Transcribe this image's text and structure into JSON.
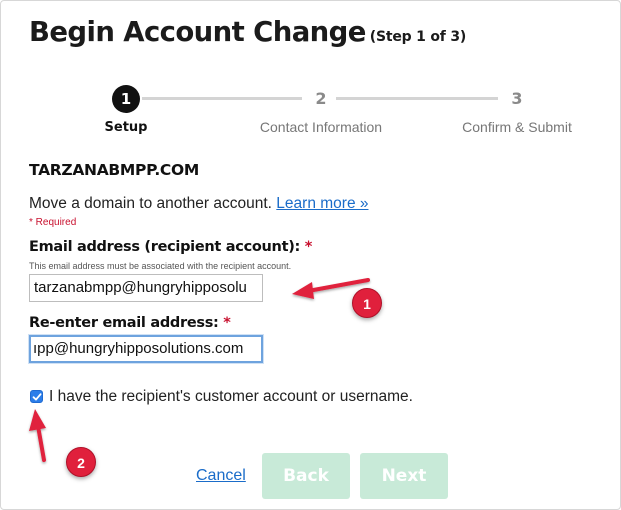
{
  "header": {
    "title": "Begin Account Change",
    "step_indicator": "(Step 1 of 3)"
  },
  "stepper": {
    "steps": [
      {
        "number": "1",
        "label": "Setup",
        "active": true
      },
      {
        "number": "2",
        "label": "Contact Information",
        "active": false
      },
      {
        "number": "3",
        "label": "Confirm & Submit",
        "active": false
      }
    ]
  },
  "domain": "TARZANABMPP.COM",
  "description": {
    "text": "Move a domain to another account.",
    "link_label": "Learn more »"
  },
  "required_note": "* Required",
  "form": {
    "email": {
      "label": "Email address (recipient account):",
      "required_mark": "*",
      "help": "This email address must be associated with the recipient account.",
      "value": "tarzanabmpp@hungryhipposolu"
    },
    "reenter": {
      "label": "Re-enter email address:",
      "required_mark": "*",
      "value": "ıpp@hungryhipposolutions.com"
    },
    "checkbox": {
      "label": "I have the recipient's customer account or username.",
      "checked": true
    }
  },
  "actions": {
    "cancel_label": "Cancel",
    "back_label": "Back",
    "next_label": "Next"
  },
  "annotations": {
    "badge_1": "1",
    "badge_2": "2"
  },
  "colors": {
    "accent_link": "#1a6cc9",
    "required_red": "#c8102e",
    "disabled_button": "#c8ead8",
    "annotation_red": "#e0203c"
  }
}
